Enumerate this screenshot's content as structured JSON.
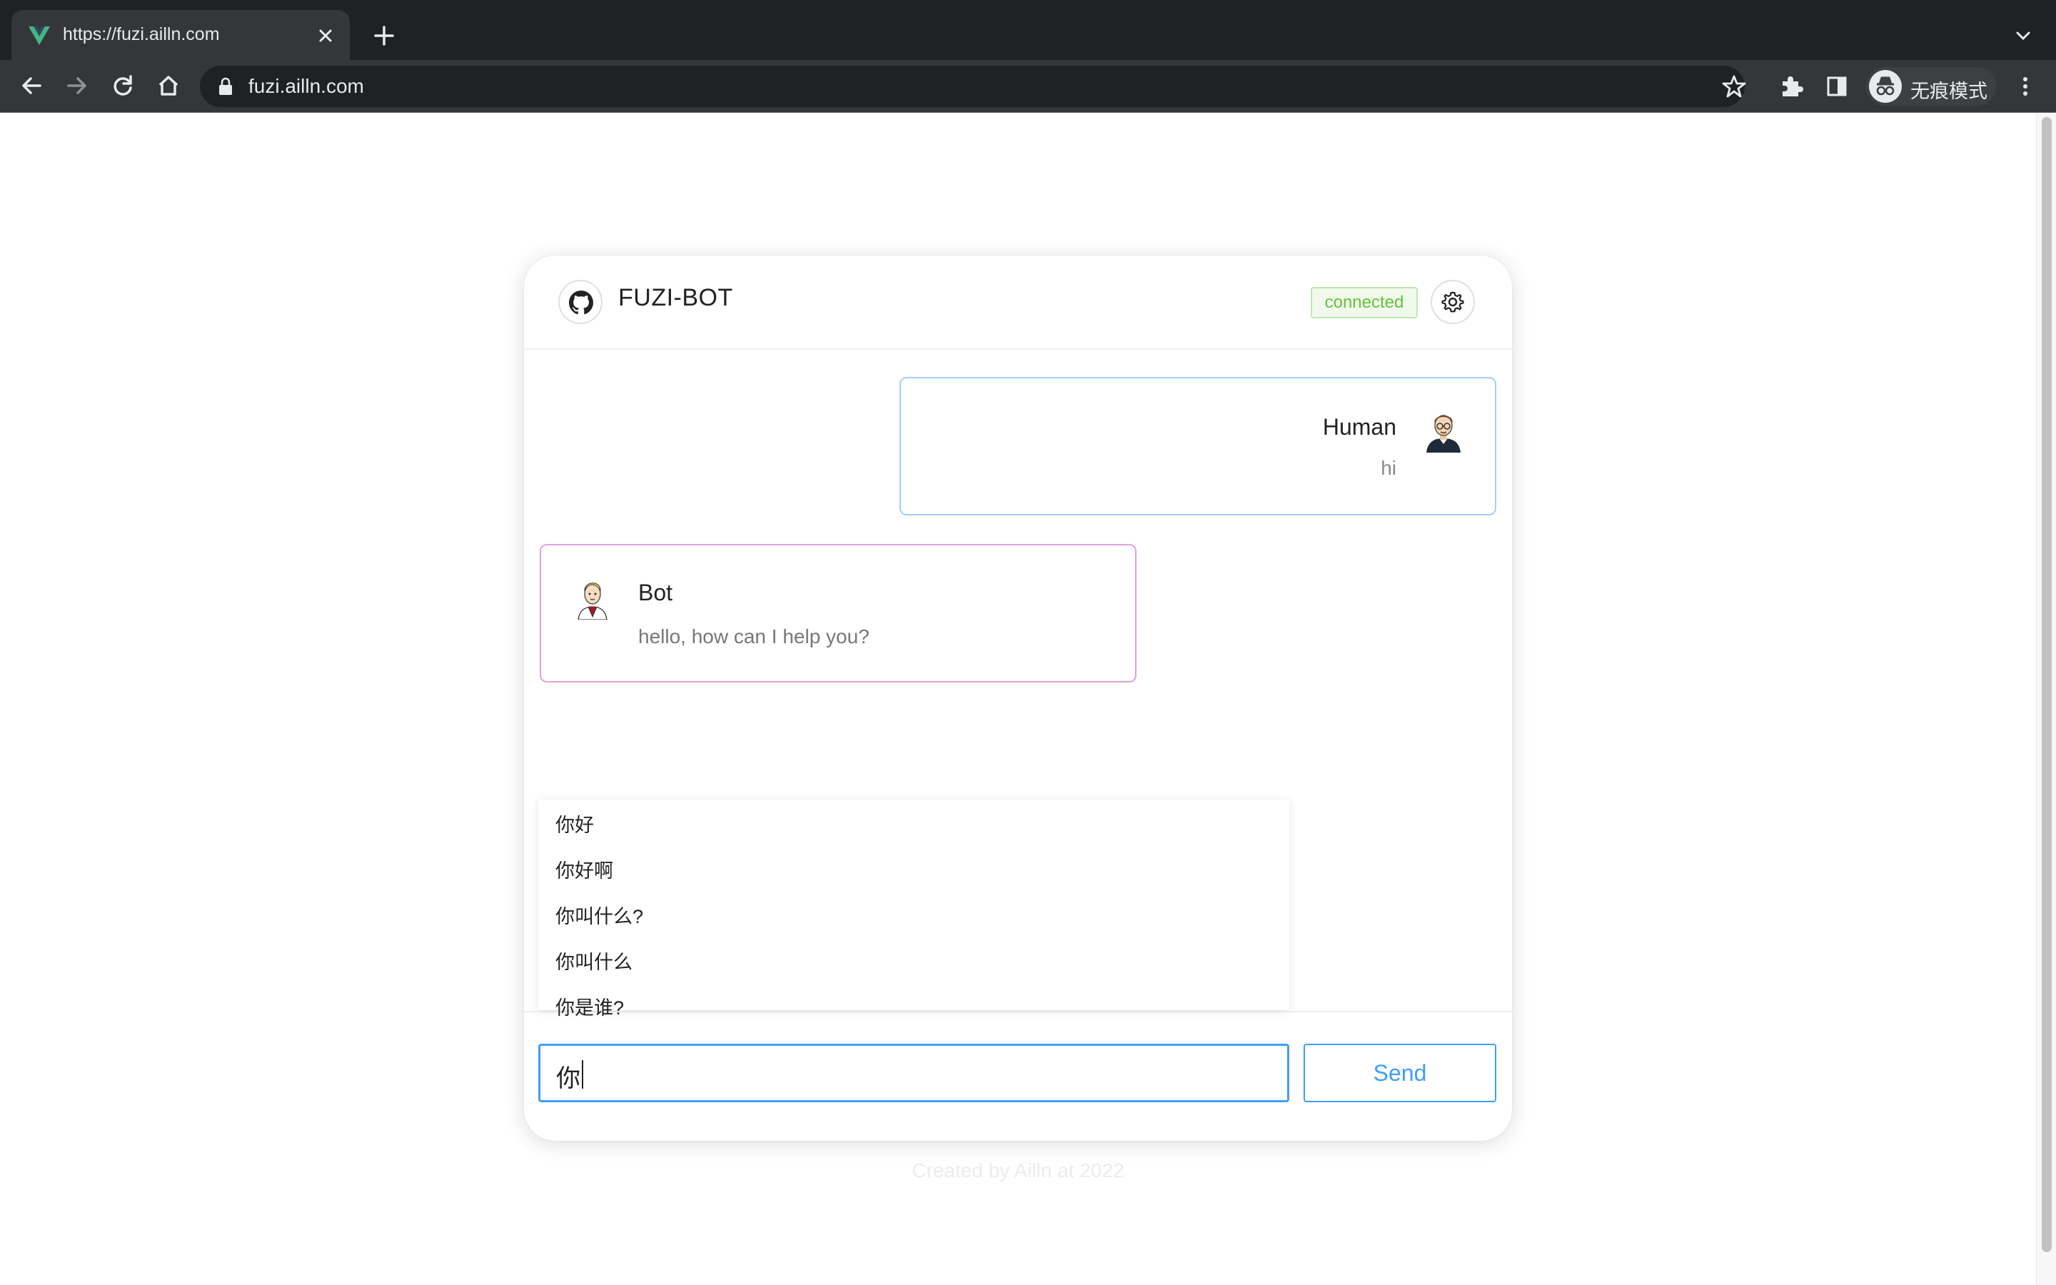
{
  "browser": {
    "tab_title": "https://fuzi.ailln.com",
    "url": "fuzi.ailln.com",
    "profile_label": "无痕模式",
    "icons": [
      "vue-favicon-icon",
      "close-icon",
      "plus-icon",
      "chevron-down-icon",
      "back-arrow-icon",
      "forward-arrow-icon",
      "reload-icon",
      "home-icon",
      "lock-icon",
      "star-icon",
      "puzzle-extension-icon",
      "side-panel-icon",
      "incognito-icon",
      "kebab-menu-icon"
    ]
  },
  "chat": {
    "title": "FUZI-BOT",
    "status": "connected",
    "messages": [
      {
        "role": "human",
        "name": "Human",
        "text": "hi"
      },
      {
        "role": "bot",
        "name": "Bot",
        "text": "hello, how can I help you?"
      }
    ],
    "suggestions": [
      "你好",
      "你好啊",
      "你叫什么?",
      "你叫什么",
      "你是谁?"
    ],
    "input_value": "你",
    "send_label": "Send",
    "colors": {
      "accent": "#409eff",
      "status_green": "#67c23a",
      "human_border": "#a0cfff",
      "bot_border": "#e0a0e0"
    }
  },
  "footer": {
    "credit": "Created by Ailln at 2022"
  }
}
